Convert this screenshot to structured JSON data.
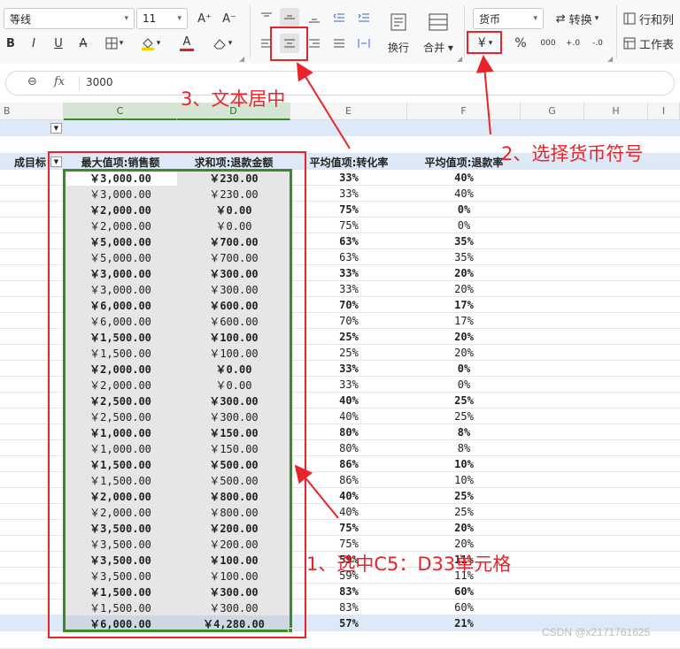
{
  "toolbar": {
    "font_name": "等线",
    "font_size": "11",
    "increase_font": "A⁺",
    "decrease_font": "A⁻",
    "bold": "B",
    "italic": "I",
    "underline": "U",
    "strike": "A",
    "font_color_letter": "A",
    "wrap_text": "换行",
    "merge": "合并",
    "number_format": "货币",
    "convert": "转换",
    "currency_symbol": "¥",
    "percent": "%",
    "thousands": "000",
    "dec_inc": "+.0",
    "dec_dec": "-.0",
    "row_col": "行和列",
    "worksheet": "工作表"
  },
  "formula_bar": {
    "value": "3000"
  },
  "columns": [
    "B",
    "C",
    "D",
    "E",
    "F",
    "G",
    "H",
    "I"
  ],
  "header_row": {
    "b_label": "成目标",
    "c_label": "最大值项:销售额",
    "d_label": "求和项:退款金额",
    "e_label": "平均值项:转化率",
    "f_label": "平均值项:退款率"
  },
  "rows": [
    {
      "c": "￥3,000.00",
      "d": "￥230.00",
      "e": "33%",
      "f": "40%",
      "bold": true
    },
    {
      "c": "￥3,000.00",
      "d": "￥230.00",
      "e": "33%",
      "f": "40%",
      "bold": false
    },
    {
      "c": "￥2,000.00",
      "d": "￥0.00",
      "e": "75%",
      "f": "0%",
      "bold": true
    },
    {
      "c": "￥2,000.00",
      "d": "￥0.00",
      "e": "75%",
      "f": "0%",
      "bold": false
    },
    {
      "c": "￥5,000.00",
      "d": "￥700.00",
      "e": "63%",
      "f": "35%",
      "bold": true
    },
    {
      "c": "￥5,000.00",
      "d": "￥700.00",
      "e": "63%",
      "f": "35%",
      "bold": false
    },
    {
      "c": "￥3,000.00",
      "d": "￥300.00",
      "e": "33%",
      "f": "20%",
      "bold": true
    },
    {
      "c": "￥3,000.00",
      "d": "￥300.00",
      "e": "33%",
      "f": "20%",
      "bold": false
    },
    {
      "c": "￥6,000.00",
      "d": "￥600.00",
      "e": "70%",
      "f": "17%",
      "bold": true
    },
    {
      "c": "￥6,000.00",
      "d": "￥600.00",
      "e": "70%",
      "f": "17%",
      "bold": false
    },
    {
      "c": "￥1,500.00",
      "d": "￥100.00",
      "e": "25%",
      "f": "20%",
      "bold": true
    },
    {
      "c": "￥1,500.00",
      "d": "￥100.00",
      "e": "25%",
      "f": "20%",
      "bold": false
    },
    {
      "c": "￥2,000.00",
      "d": "￥0.00",
      "e": "33%",
      "f": "0%",
      "bold": true
    },
    {
      "c": "￥2,000.00",
      "d": "￥0.00",
      "e": "33%",
      "f": "0%",
      "bold": false
    },
    {
      "c": "￥2,500.00",
      "d": "￥300.00",
      "e": "40%",
      "f": "25%",
      "bold": true
    },
    {
      "c": "￥2,500.00",
      "d": "￥300.00",
      "e": "40%",
      "f": "25%",
      "bold": false
    },
    {
      "c": "￥1,000.00",
      "d": "￥150.00",
      "e": "80%",
      "f": "8%",
      "bold": true
    },
    {
      "c": "￥1,000.00",
      "d": "￥150.00",
      "e": "80%",
      "f": "8%",
      "bold": false
    },
    {
      "c": "￥1,500.00",
      "d": "￥500.00",
      "e": "86%",
      "f": "10%",
      "bold": true
    },
    {
      "c": "￥1,500.00",
      "d": "￥500.00",
      "e": "86%",
      "f": "10%",
      "bold": false
    },
    {
      "c": "￥2,000.00",
      "d": "￥800.00",
      "e": "40%",
      "f": "25%",
      "bold": true
    },
    {
      "c": "￥2,000.00",
      "d": "￥800.00",
      "e": "40%",
      "f": "25%",
      "bold": false
    },
    {
      "c": "￥3,500.00",
      "d": "￥200.00",
      "e": "75%",
      "f": "20%",
      "bold": true
    },
    {
      "c": "￥3,500.00",
      "d": "￥200.00",
      "e": "75%",
      "f": "20%",
      "bold": false
    },
    {
      "c": "￥3,500.00",
      "d": "￥100.00",
      "e": "59%",
      "f": "11%",
      "bold": true
    },
    {
      "c": "￥3,500.00",
      "d": "￥100.00",
      "e": "59%",
      "f": "11%",
      "bold": false
    },
    {
      "c": "￥1,500.00",
      "d": "￥300.00",
      "e": "83%",
      "f": "60%",
      "bold": true
    },
    {
      "c": "￥1,500.00",
      "d": "￥300.00",
      "e": "83%",
      "f": "60%",
      "bold": false
    }
  ],
  "total_row": {
    "c": "￥6,000.00",
    "d": "￥4,280.00",
    "e": "57%",
    "f": "21%"
  },
  "annotations": {
    "step1": "1、选中C5：D33单元格",
    "step2": "2、选择货币符号",
    "step3": "3、文本居中"
  },
  "watermark": "CSDN @x2171761625",
  "colors": {
    "annotation_red": "#e8242b",
    "selection_green": "#3a8a2a",
    "total_row_bg": "#dde9f7",
    "selected_fill": "#e6e6e6"
  }
}
